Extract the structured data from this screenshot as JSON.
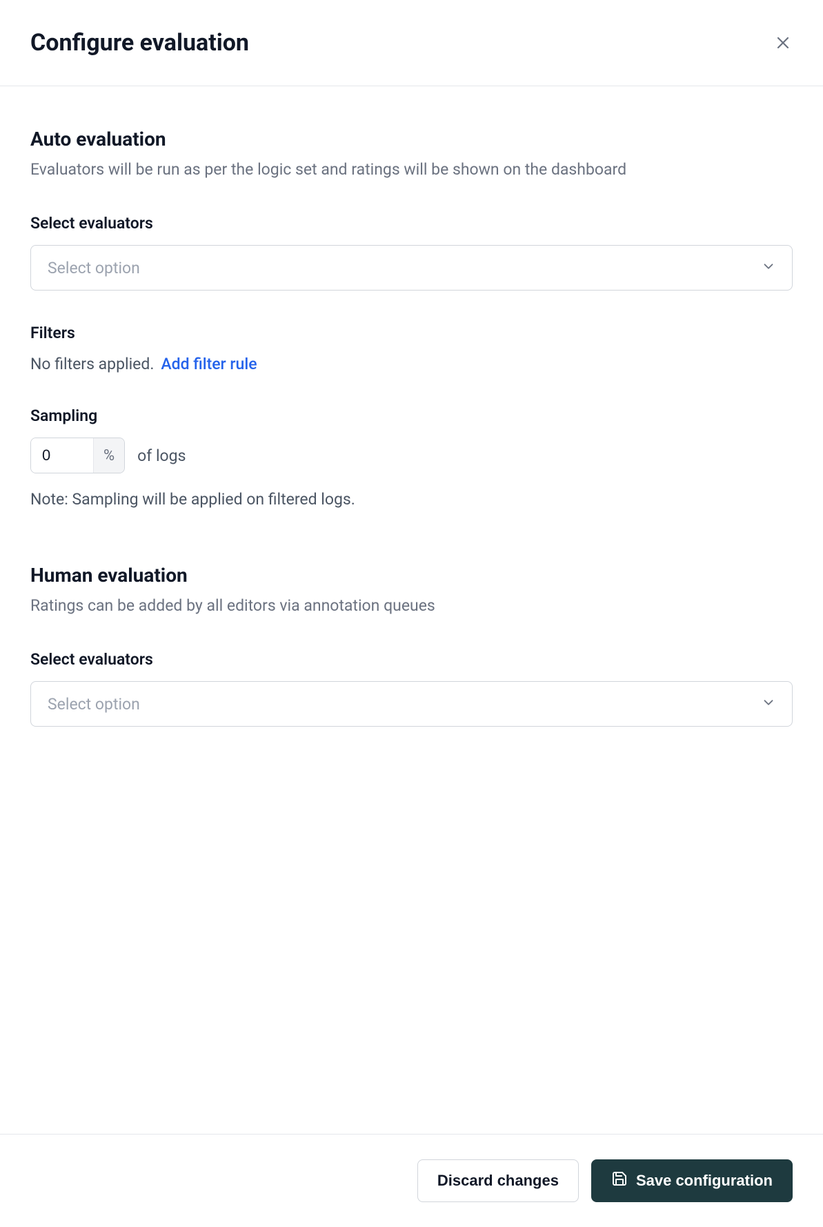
{
  "header": {
    "title": "Configure evaluation"
  },
  "auto": {
    "title": "Auto evaluation",
    "desc": "Evaluators will be run as per the logic set and ratings will be shown on the dashboard",
    "selectLabel": "Select evaluators",
    "selectPlaceholder": "Select option",
    "filtersLabel": "Filters",
    "filtersEmpty": "No filters applied.",
    "filtersLink": "Add filter rule",
    "samplingLabel": "Sampling",
    "samplingValue": "0",
    "samplingSuffix": "%",
    "samplingText": "of logs",
    "samplingNote": "Note: Sampling will be applied on filtered logs."
  },
  "human": {
    "title": "Human evaluation",
    "desc": "Ratings can be added by all editors via annotation queues",
    "selectLabel": "Select evaluators",
    "selectPlaceholder": "Select option"
  },
  "footer": {
    "discard": "Discard changes",
    "save": "Save configuration"
  }
}
